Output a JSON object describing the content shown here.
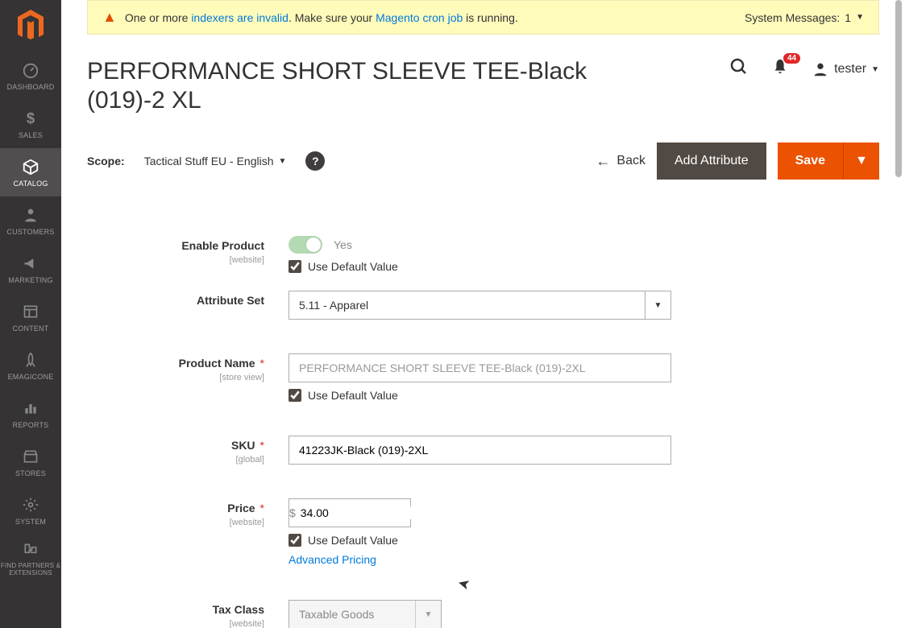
{
  "systemMessage": {
    "prefix": "One or more ",
    "link1": "indexers are invalid",
    "mid": ". Make sure your ",
    "link2": "Magento cron job",
    "suffix": " is running.",
    "rightLabel": "System Messages:",
    "rightCount": "1"
  },
  "nav": {
    "dashboard": "DASHBOARD",
    "sales": "SALES",
    "catalog": "CATALOG",
    "customers": "CUSTOMERS",
    "marketing": "MARKETING",
    "content": "CONTENT",
    "emagicone": "EMAGICONE",
    "reports": "REPORTS",
    "stores": "STORES",
    "system": "SYSTEM",
    "partners": "FIND PARTNERS & EXTENSIONS"
  },
  "header": {
    "title": "PERFORMANCE SHORT SLEEVE TEE-Black (019)-2 XL",
    "notifCount": "44",
    "user": "tester"
  },
  "toolbar": {
    "scopeLabel": "Scope:",
    "scopeValue": "Tactical Stuff EU - English",
    "back": "Back",
    "addAttribute": "Add Attribute",
    "save": "Save"
  },
  "form": {
    "enableProduct": {
      "label": "Enable Product",
      "scope": "[website]",
      "toggleText": "Yes",
      "useDefault": "Use Default Value"
    },
    "attributeSet": {
      "label": "Attribute Set",
      "value": "5.11 - Apparel"
    },
    "productName": {
      "label": "Product Name",
      "scope": "[store view]",
      "placeholder": "PERFORMANCE SHORT SLEEVE TEE-Black (019)-2XL",
      "useDefault": "Use Default Value"
    },
    "sku": {
      "label": "SKU",
      "scope": "[global]",
      "value": "41223JK-Black (019)-2XL"
    },
    "price": {
      "label": "Price",
      "scope": "[website]",
      "currency": "$",
      "value": "34.00",
      "useDefault": "Use Default Value",
      "advancedPricing": "Advanced Pricing"
    },
    "taxClass": {
      "label": "Tax Class",
      "scope": "[website]",
      "value": "Taxable Goods"
    }
  }
}
